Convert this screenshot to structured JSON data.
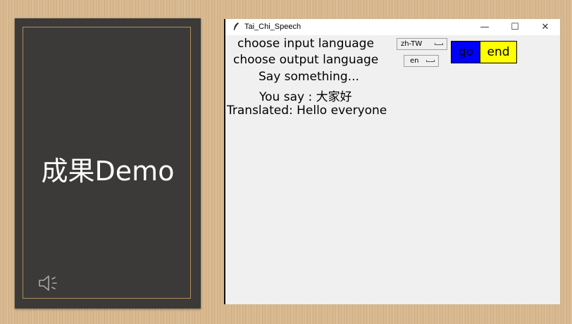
{
  "slide": {
    "title": "成果Demo",
    "audio_icon": "speaker-icon"
  },
  "window": {
    "title": "Tai_Chi_Speech",
    "app_icon": "feather-icon",
    "minimize": "—",
    "maximize": "☐",
    "close": "✕"
  },
  "app": {
    "input_label": "choose input language",
    "input_value": "zh-TW",
    "output_label": "choose output language",
    "output_value": "en",
    "go_label": "go",
    "end_label": "end",
    "prompt": "Say something...",
    "you_say": "You say : 大家好",
    "translated": "Translated: Hello everyone"
  },
  "colors": {
    "go_button": "#0000ff",
    "end_button": "#ffff00",
    "card_background": "#3b3a39",
    "card_border": "#b08d5a"
  }
}
